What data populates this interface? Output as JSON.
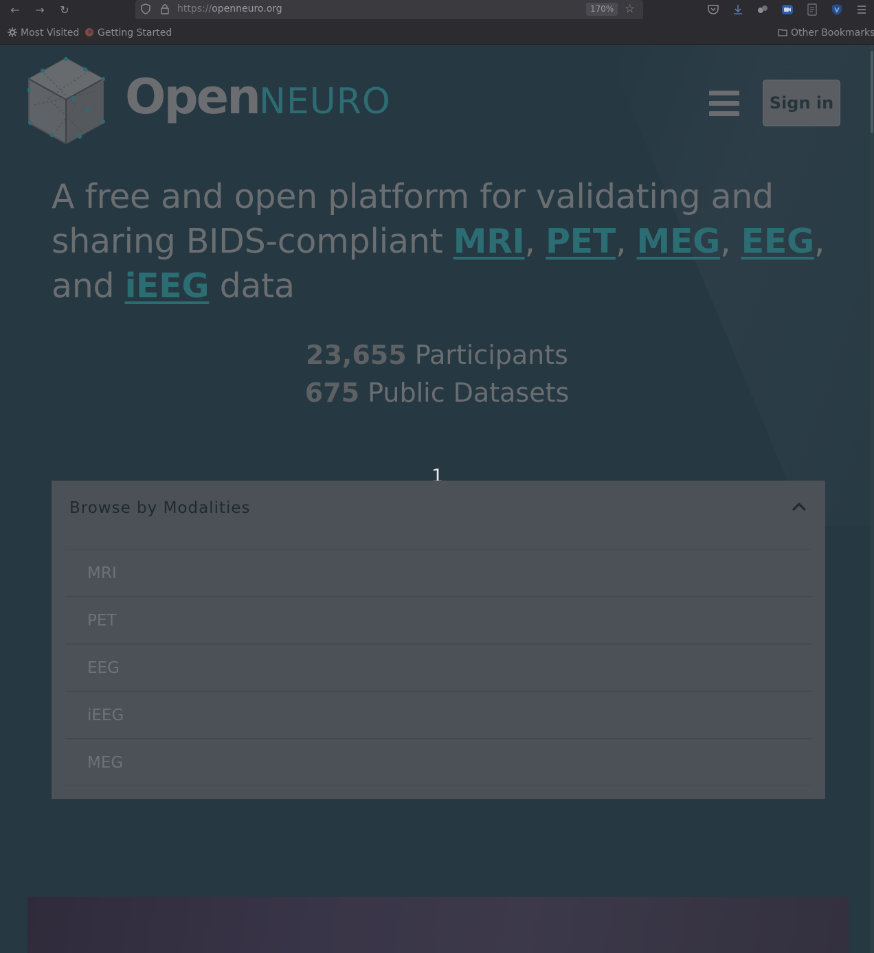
{
  "browser": {
    "url_prefix": "https://",
    "url_host": "openneuro.org",
    "zoom": "170%",
    "bookmarks": {
      "most_visited": "Most Visited",
      "getting_started": "Getting Started",
      "other": "Other Bookmarks"
    }
  },
  "header": {
    "logo_open": "Open",
    "logo_neuro": "NEURO",
    "signin_label": "Sign in"
  },
  "hero": {
    "part1": "A free and open platform for validating and sharing BIDS-compliant ",
    "mri": "MRI",
    "sep1": ", ",
    "pet": "PET",
    "sep2": ", ",
    "meg": "MEG",
    "sep3": ", ",
    "eeg": "EEG",
    "part2": ", and ",
    "ieeg": "iEEG",
    "part3": " data"
  },
  "stats": {
    "participants_count": "23,655",
    "participants_label": " Participants",
    "datasets_count": "675",
    "datasets_label": " Public Datasets"
  },
  "overlay_marker": "1",
  "browse": {
    "title": "Browse by Modalities",
    "items": [
      "MRI",
      "PET",
      "EEG",
      "iEEG",
      "MEG"
    ]
  },
  "colors": {
    "accent": "#2c6d73",
    "page_bg": "#263842",
    "panel_bg": "#4b5157"
  }
}
